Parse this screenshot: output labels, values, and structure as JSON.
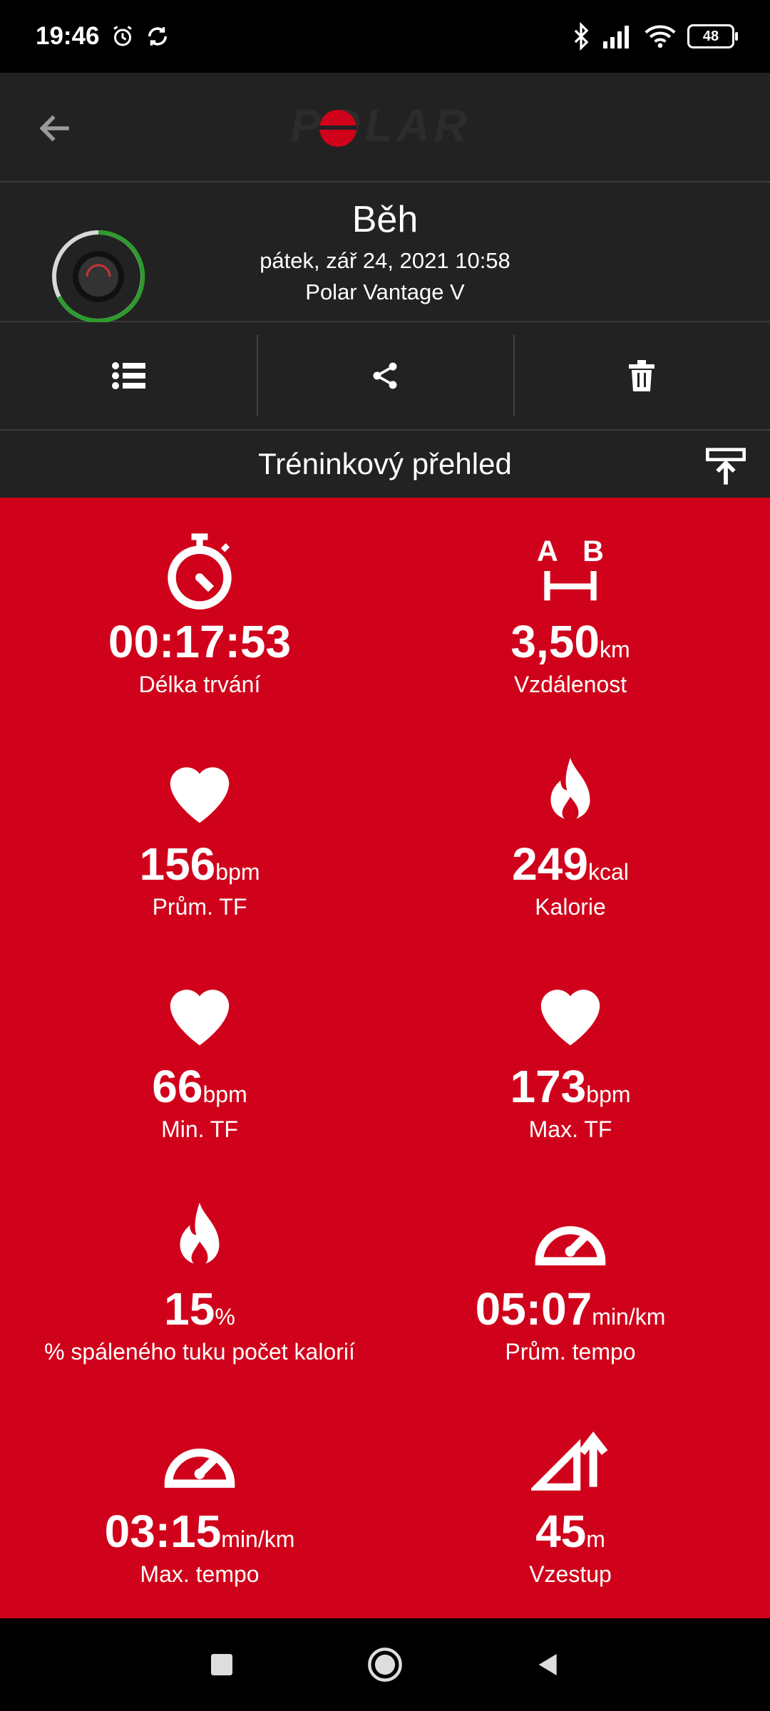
{
  "status": {
    "time": "19:46",
    "battery": "48"
  },
  "header": {
    "back_icon": "arrow-left-icon",
    "brand": "POLAR"
  },
  "session": {
    "title": "Běh",
    "date": "pátek, zář 24, 2021 10:58",
    "device": "Polar Vantage V"
  },
  "toolbar": {
    "icons": [
      "list-icon",
      "share-icon",
      "trash-icon"
    ]
  },
  "section": {
    "title": "Tréninkový přehled",
    "pin_icon": "pin-top-icon"
  },
  "stats": [
    {
      "icon": "stopwatch-icon",
      "value": "00:17:53",
      "unit": "",
      "label": "Délka trvání"
    },
    {
      "icon": "distance-icon",
      "value": "3,50",
      "unit": "km",
      "label": "Vzdálenost"
    },
    {
      "icon": "heart-icon",
      "value": "156",
      "unit": "bpm",
      "label": "Prům. TF"
    },
    {
      "icon": "flame-icon",
      "value": "249",
      "unit": "kcal",
      "label": "Kalorie"
    },
    {
      "icon": "heart-icon",
      "value": "66",
      "unit": "bpm",
      "label": "Min. TF"
    },
    {
      "icon": "heart-icon",
      "value": "173",
      "unit": "bpm",
      "label": "Max. TF"
    },
    {
      "icon": "flame-icon",
      "value": "15",
      "unit": "%",
      "label": "% spáleného tuku počet kalorií"
    },
    {
      "icon": "speedometer-icon",
      "value": "05:07",
      "unit": "min/km",
      "label": "Prům. tempo"
    },
    {
      "icon": "speedometer-icon",
      "value": "03:15",
      "unit": "min/km",
      "label": "Max. tempo"
    },
    {
      "icon": "ascent-icon",
      "value": "45",
      "unit": "m",
      "label": "Vzestup"
    }
  ],
  "colors": {
    "accent": "#d0021b",
    "panel": "#222222",
    "ring": "#2d9b2d"
  }
}
